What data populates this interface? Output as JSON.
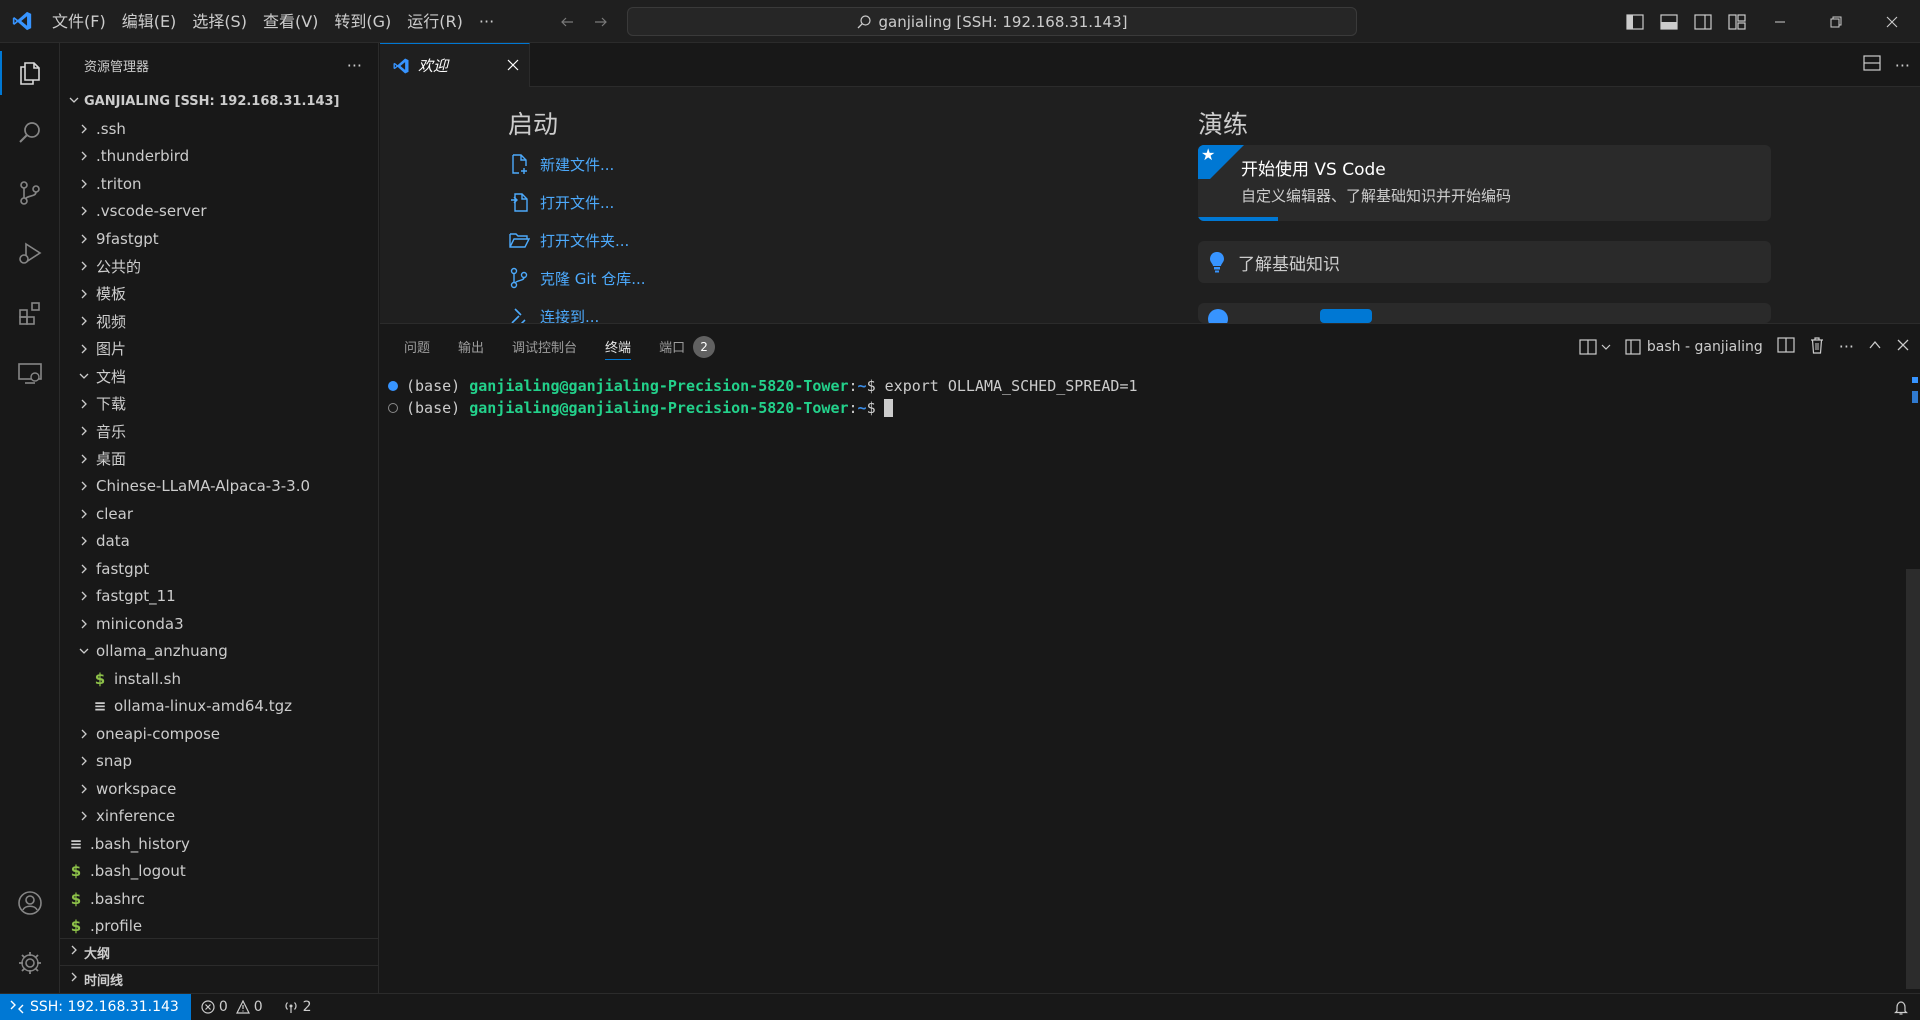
{
  "titlebar": {
    "menus": [
      "文件(F)",
      "编辑(E)",
      "选择(S)",
      "查看(V)",
      "转到(G)",
      "运行(R)",
      "···"
    ],
    "search_text": "ganjialing [SSH: 192.168.31.143]"
  },
  "sidebar": {
    "title": "资源管理器",
    "more": "···",
    "root": "GANJIALING [SSH: 192.168.31.143]",
    "items": [
      {
        "label": ".ssh",
        "kind": "folder",
        "open": false,
        "depth": 0
      },
      {
        "label": ".thunderbird",
        "kind": "folder",
        "open": false,
        "depth": 0
      },
      {
        "label": ".triton",
        "kind": "folder",
        "open": false,
        "depth": 0
      },
      {
        "label": ".vscode-server",
        "kind": "folder",
        "open": false,
        "depth": 0
      },
      {
        "label": "9fastgpt",
        "kind": "folder",
        "open": false,
        "depth": 0
      },
      {
        "label": "公共的",
        "kind": "folder",
        "open": false,
        "depth": 0
      },
      {
        "label": "模板",
        "kind": "folder",
        "open": false,
        "depth": 0
      },
      {
        "label": "视频",
        "kind": "folder",
        "open": false,
        "depth": 0
      },
      {
        "label": "图片",
        "kind": "folder",
        "open": false,
        "depth": 0
      },
      {
        "label": "文档",
        "kind": "folder",
        "open": true,
        "depth": 0
      },
      {
        "label": "下载",
        "kind": "folder",
        "open": false,
        "depth": 0
      },
      {
        "label": "音乐",
        "kind": "folder",
        "open": false,
        "depth": 0
      },
      {
        "label": "桌面",
        "kind": "folder",
        "open": false,
        "depth": 0
      },
      {
        "label": "Chinese-LLaMA-Alpaca-3-3.0",
        "kind": "folder",
        "open": false,
        "depth": 0
      },
      {
        "label": "clear",
        "kind": "folder",
        "open": false,
        "depth": 0
      },
      {
        "label": "data",
        "kind": "folder",
        "open": false,
        "depth": 0
      },
      {
        "label": "fastgpt",
        "kind": "folder",
        "open": false,
        "depth": 0
      },
      {
        "label": "fastgpt_11",
        "kind": "folder",
        "open": false,
        "depth": 0
      },
      {
        "label": "miniconda3",
        "kind": "folder",
        "open": false,
        "depth": 0
      },
      {
        "label": "ollama_anzhuang",
        "kind": "folder",
        "open": true,
        "depth": 0
      },
      {
        "label": "install.sh",
        "kind": "shell",
        "depth": 1
      },
      {
        "label": "ollama-linux-amd64.tgz",
        "kind": "text",
        "depth": 1
      },
      {
        "label": "oneapi-compose",
        "kind": "folder",
        "open": false,
        "depth": 0
      },
      {
        "label": "snap",
        "kind": "folder",
        "open": false,
        "depth": 0
      },
      {
        "label": "workspace",
        "kind": "folder",
        "open": false,
        "depth": 0
      },
      {
        "label": "xinference",
        "kind": "folder",
        "open": false,
        "depth": 0
      },
      {
        "label": ".bash_history",
        "kind": "text",
        "depth": -1
      },
      {
        "label": ".bash_logout",
        "kind": "shell",
        "depth": -1
      },
      {
        "label": ".bashrc",
        "kind": "shell",
        "depth": -1
      },
      {
        "label": ".profile",
        "kind": "shell",
        "depth": -1
      }
    ],
    "outline": "大纲",
    "timeline": "时间线"
  },
  "editor": {
    "tab_label": "欢迎",
    "start_heading": "启动",
    "start_items": [
      "新建文件...",
      "打开文件...",
      "打开文件夹...",
      "克隆 Git 仓库...",
      "连接到..."
    ],
    "walk_heading": "演练",
    "walk_card_title": "开始使用 VS Code",
    "walk_card_desc": "自定义编辑器、了解基础知识并开始编码",
    "walk_card_progress": 0.14,
    "basics_label": "了解基础知识"
  },
  "panel": {
    "tabs": [
      "问题",
      "输出",
      "调试控制台",
      "终端",
      "端口"
    ],
    "active_tab": "终端",
    "ports_count": "2",
    "terminal_name": "bash - ganjialing",
    "lines": [
      {
        "prefix": "(base) ",
        "user": "ganjialing@ganjialing-Precision-5820-Tower",
        "sep": ":",
        "path": "~",
        "prompt": "$ ",
        "cmd": "export OLLAMA_SCHED_SPREAD=1",
        "status": "done"
      },
      {
        "prefix": "(base) ",
        "user": "ganjialing@ganjialing-Precision-5820-Tower",
        "sep": ":",
        "path": "~",
        "prompt": "$",
        "cmd": "",
        "status": "pending"
      }
    ]
  },
  "statusbar": {
    "remote": "SSH: 192.168.31.143",
    "errors": "0",
    "warnings": "0",
    "ports": "2"
  },
  "colors": {
    "accent": "#0078d4",
    "link": "#4daafc",
    "term_user": "#23d18b",
    "term_path": "#3b8eea",
    "shell_icon": "#8dc149"
  }
}
